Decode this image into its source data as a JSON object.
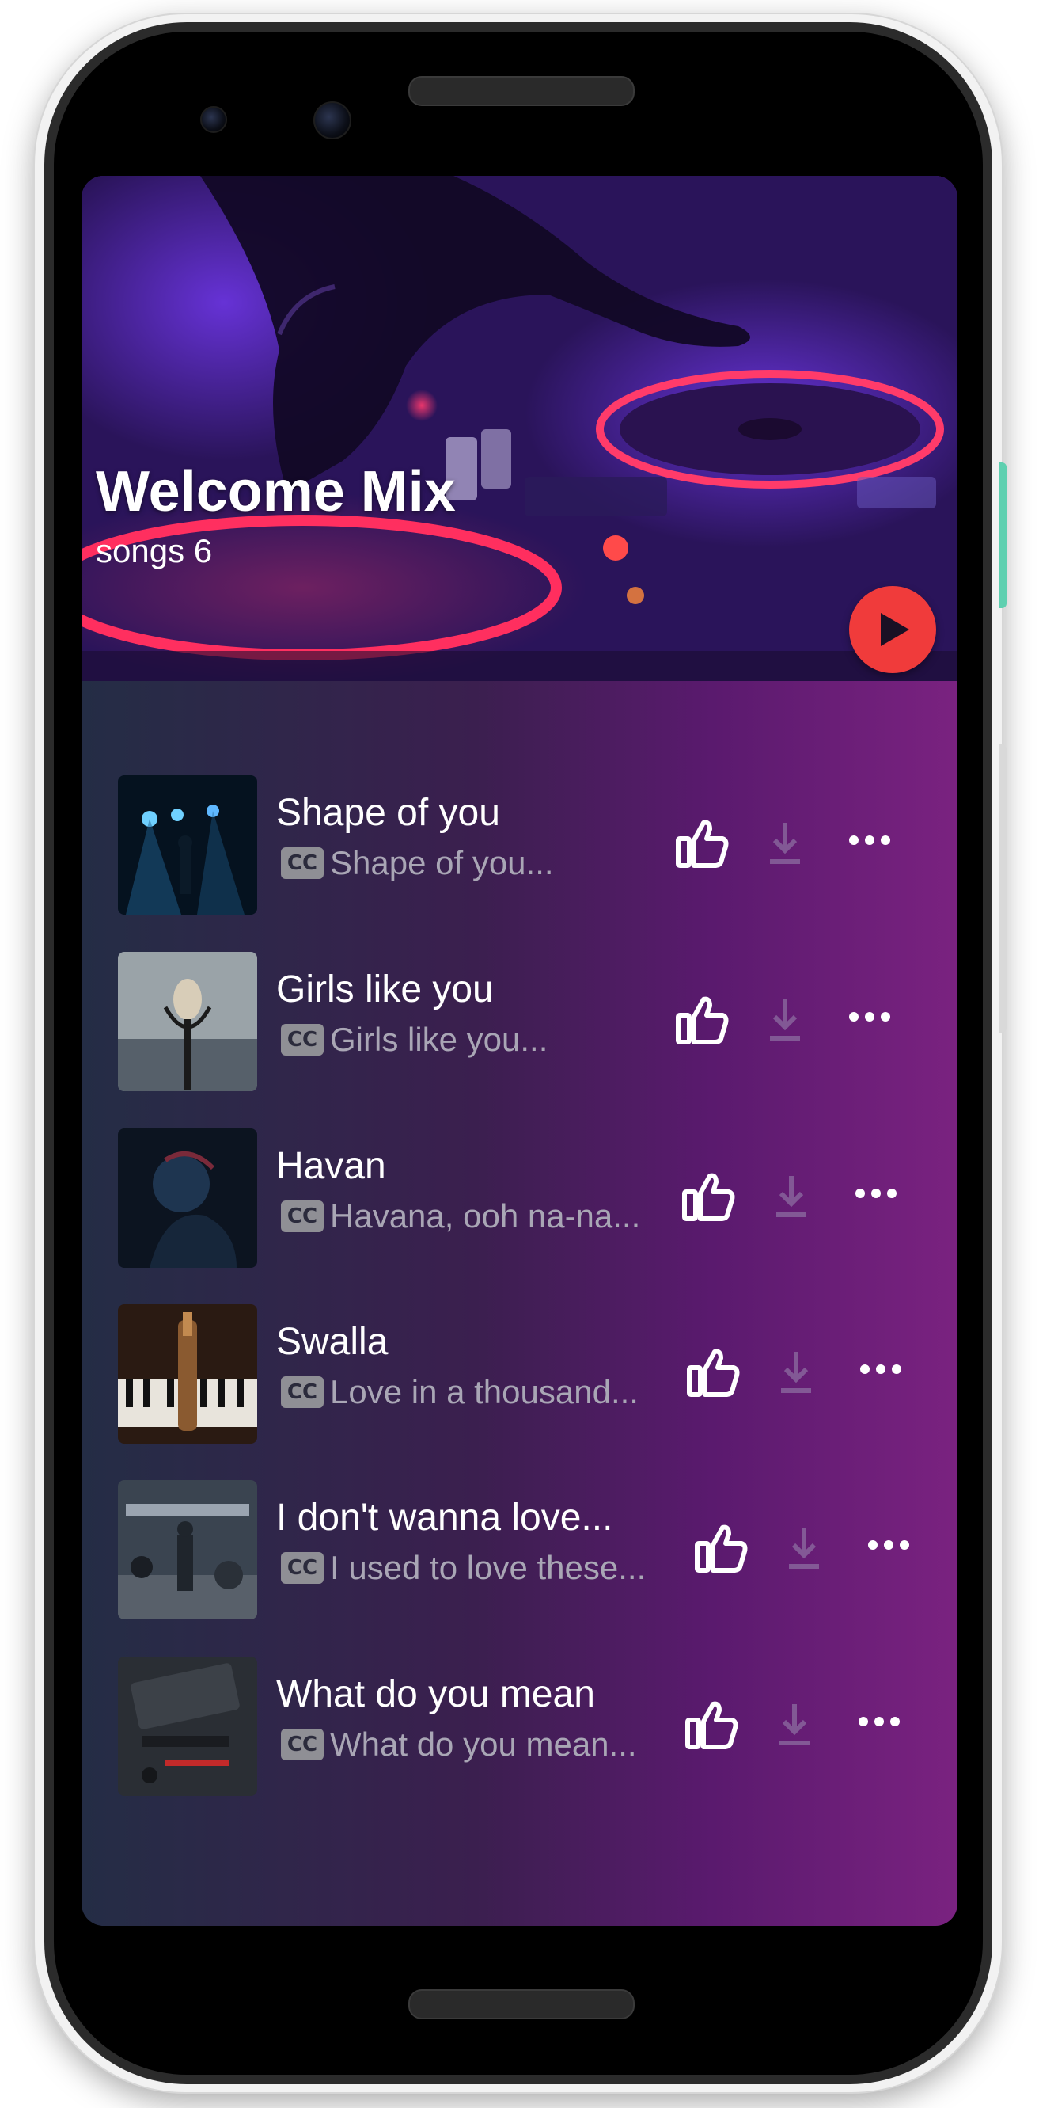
{
  "playlist": {
    "title": "Welcome Mix",
    "subtitle": "songs 6"
  },
  "icons": {
    "play": "play-icon",
    "like": "thumbs-up-icon",
    "download": "download-icon",
    "more": "more-horizontal-icon",
    "captions": "closed-captions-icon"
  },
  "cc_label": "CC",
  "colors": {
    "play_button": "#f03b3b",
    "gradient_start": "#242d45",
    "gradient_end": "#7a2280",
    "subtitle_text": "#a9a6b5"
  },
  "songs": [
    {
      "title": "Shape of you",
      "subtitle": "Shape of you..."
    },
    {
      "title": "Girls like you",
      "subtitle": "Girls like you..."
    },
    {
      "title": "Havan",
      "subtitle": "Havana, ooh na-na..."
    },
    {
      "title": "Swalla",
      "subtitle": "Love in a thousand..."
    },
    {
      "title": "I don't wanna love...",
      "subtitle": "I used to love these..."
    },
    {
      "title": "What do you mean",
      "subtitle": "What do you mean..."
    }
  ]
}
